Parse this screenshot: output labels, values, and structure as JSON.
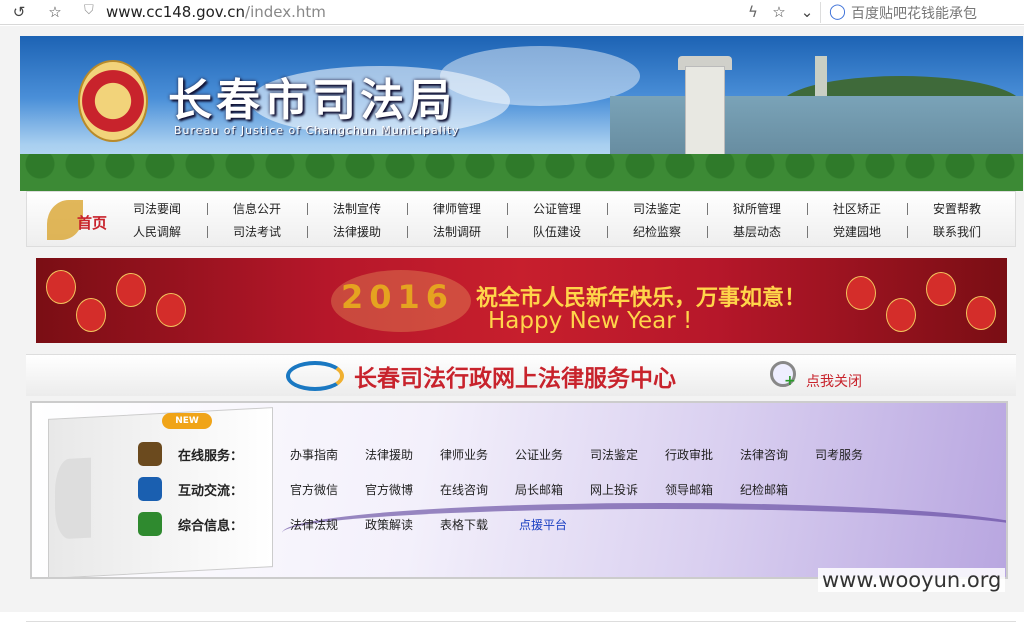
{
  "browser": {
    "url_domain": "www.cc148.gov.cn",
    "url_path": "/index.htm",
    "search_placeholder": "百度贴吧花钱能承包"
  },
  "header": {
    "title": "长春市司法局",
    "subtitle": "Bureau of Justice of Changchun Municipality"
  },
  "nav": {
    "home_label": "首页",
    "row1": [
      "司法要闻",
      "信息公开",
      "法制宣传",
      "律师管理",
      "公证管理",
      "司法鉴定",
      "狱所管理",
      "社区矫正",
      "安置帮教"
    ],
    "row2": [
      "人民调解",
      "司法考试",
      "法律援助",
      "法制调研",
      "队伍建设",
      "纪检监察",
      "基层动态",
      "党建园地",
      "联系我们"
    ]
  },
  "banner": {
    "year": "2016",
    "line1": "祝全市人民新年快乐，万事如意！",
    "line2": "Happy New Year !"
  },
  "service_center": {
    "title": "长春司法行政网上法律服务中心",
    "close_label": "点我关闭"
  },
  "panel": {
    "new_badge": "NEW",
    "rows": [
      {
        "label": "在线服务：",
        "icon": "briefcase-icon",
        "links": [
          "办事指南",
          "法律援助",
          "律师业务",
          "公证业务",
          "司法鉴定",
          "行政审批",
          "法律咨询",
          "司考服务"
        ]
      },
      {
        "label": "互动交流：",
        "icon": "globe-icon",
        "links": [
          "官方微信",
          "官方微博",
          "在线咨询",
          "局长邮箱",
          "网上投诉",
          "领导邮箱",
          "纪检邮箱"
        ]
      },
      {
        "label": "综合信息：",
        "icon": "headset-icon",
        "links": [
          "法律法规",
          "政策解读",
          "表格下载",
          "点援平台"
        ]
      }
    ]
  },
  "watermark": "www.wooyun.org",
  "colors": {
    "brand_red": "#c8232c",
    "gold": "#ffd54a",
    "link_blue": "#1a3fc2"
  }
}
